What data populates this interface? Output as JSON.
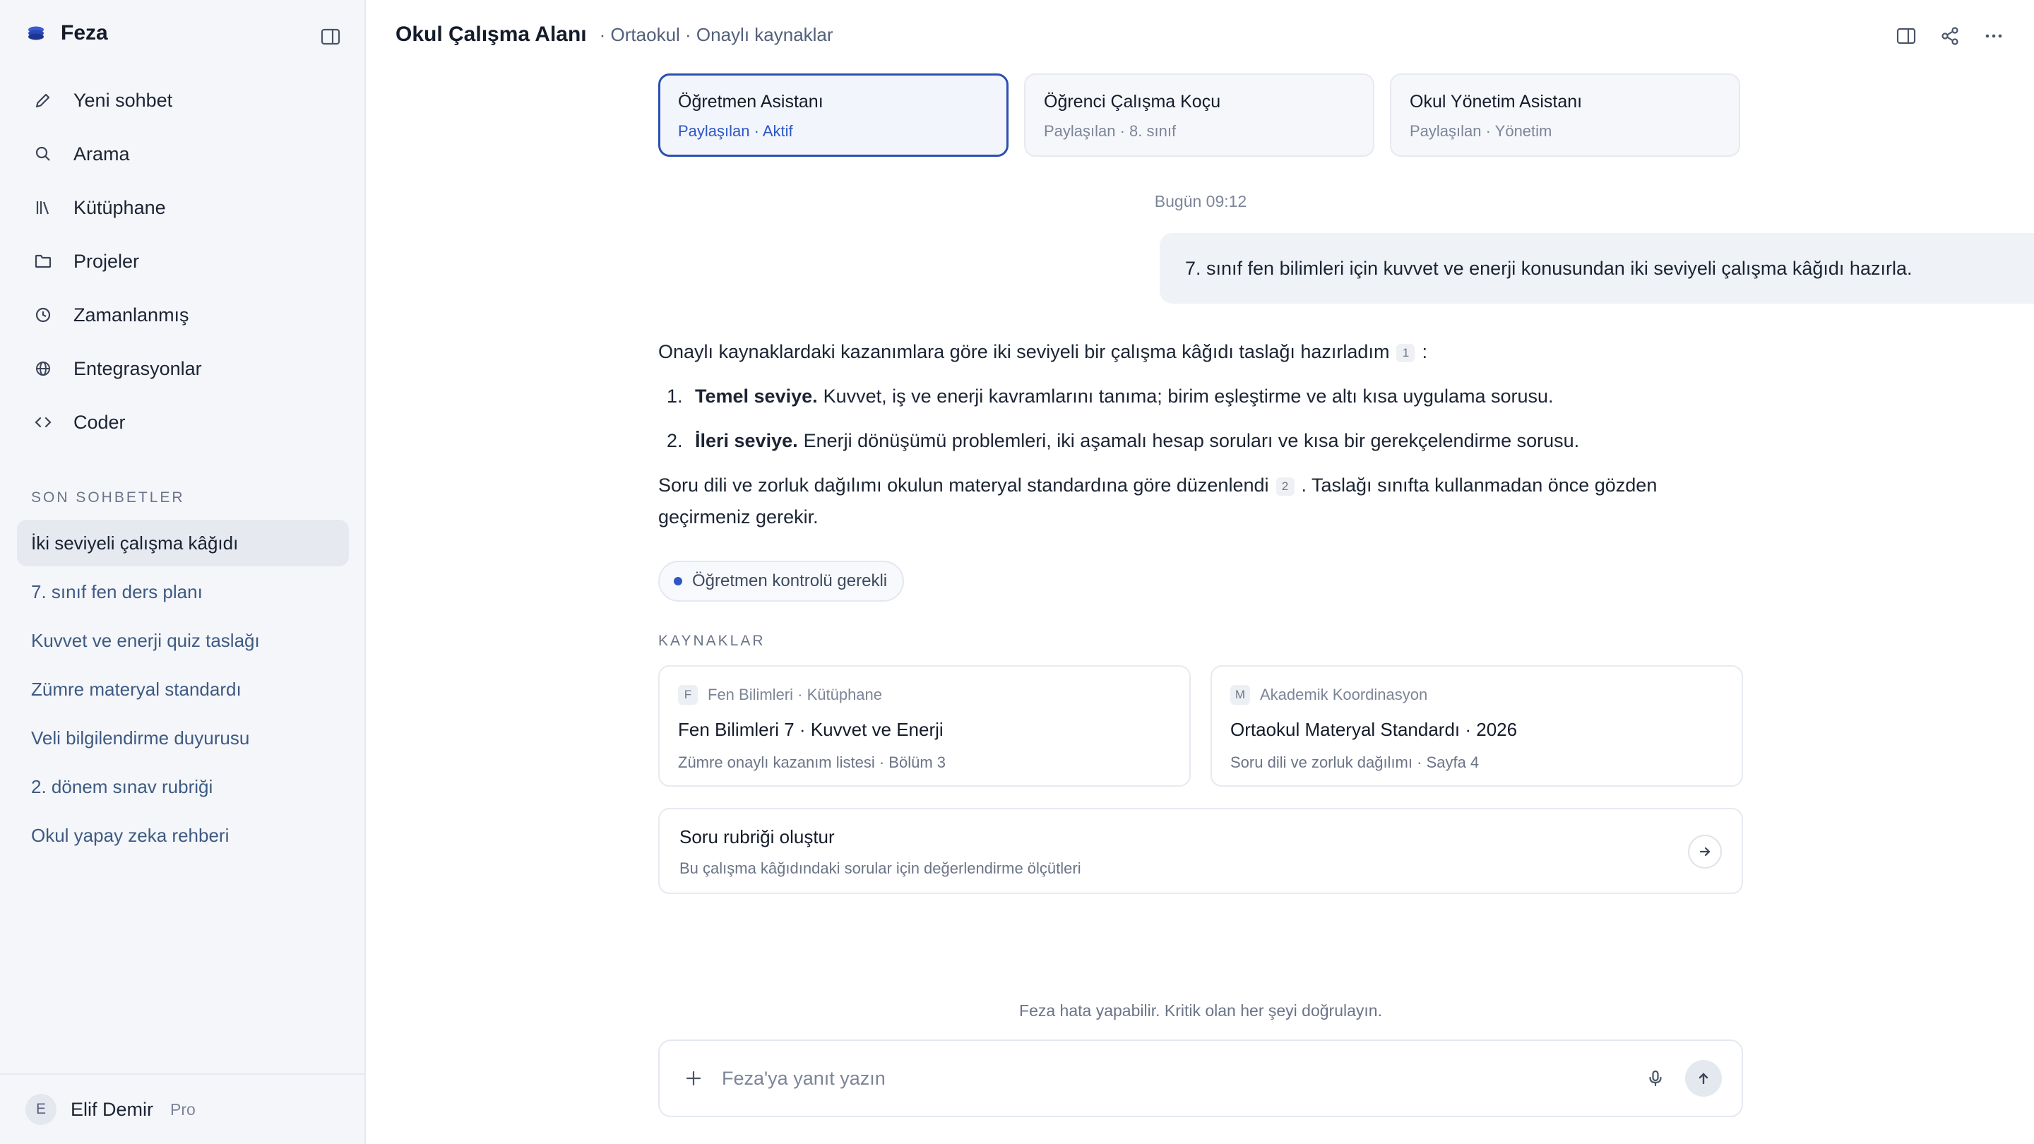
{
  "app": {
    "name": "Feza"
  },
  "sidebar": {
    "nav": [
      {
        "label": "Yeni sohbet",
        "icon": "pencil-icon"
      },
      {
        "label": "Arama",
        "icon": "search-icon"
      },
      {
        "label": "Kütüphane",
        "icon": "library-icon"
      },
      {
        "label": "Projeler",
        "icon": "folder-icon"
      },
      {
        "label": "Zamanlanmış",
        "icon": "clock-icon"
      },
      {
        "label": "Entegrasyonlar",
        "icon": "globe-icon"
      },
      {
        "label": "Coder",
        "icon": "code-icon"
      }
    ],
    "recents_title": "SON SOHBETLER",
    "recents": [
      "İki seviyeli çalışma kâğıdı",
      "7. sınıf fen ders planı",
      "Kuvvet ve enerji quiz taslağı",
      "Zümre materyal standardı",
      "Veli bilgilendirme duyurusu",
      "2. dönem sınav rubriği",
      "Okul yapay zeka rehberi"
    ],
    "user": {
      "initial": "E",
      "name": "Elif Demir",
      "plan": "Pro"
    }
  },
  "header": {
    "title": "Okul Çalışma Alanı",
    "subtitle": "· Ortaokul · Onaylı kaynaklar"
  },
  "assistants": [
    {
      "name": "Öğretmen Asistanı",
      "meta": "Paylaşılan · Aktif",
      "active": true
    },
    {
      "name": "Öğrenci Çalışma Koçu",
      "meta": "Paylaşılan · 8. sınıf",
      "active": false
    },
    {
      "name": "Okul Yönetim Asistanı",
      "meta": "Paylaşılan · Yönetim",
      "active": false
    }
  ],
  "conversation": {
    "timestamp": "Bugün 09:12",
    "user_message": "7. sınıf fen bilimleri için kuvvet ve enerji konusundan iki seviyeli çalışma kâğıdı hazırla.",
    "intro": "Onaylı kaynaklardaki kazanımlara göre iki seviyeli bir çalışma kâğıdı taslağı hazırladım",
    "intro_cite": "1",
    "intro_end": ":",
    "items": [
      {
        "num": "1.",
        "title": "Temel seviye.",
        "text": "Kuvvet, iş ve enerji kavramlarını tanıma; birim eşleştirme ve altı kısa uygulama sorusu."
      },
      {
        "num": "2.",
        "title": "İleri seviye.",
        "text": "Enerji dönüşümü problemleri, iki aşamalı hesap soruları ve kısa bir gerekçelendirme sorusu."
      }
    ],
    "outro_start": "Soru dili ve zorluk dağılımı okulun materyal standardına göre düzenlendi",
    "outro_cite": "2",
    "outro_end": ". Taslağı sınıfta kullanmadan önce gözden geçirmeniz gerekir.",
    "badge": "Öğretmen kontrolü gerekli"
  },
  "sources": {
    "title": "KAYNAKLAR",
    "items": [
      {
        "letter": "F",
        "origin": "Fen Bilimleri · Kütüphane",
        "title": "Fen Bilimleri 7 · Kuvvet ve Enerji",
        "detail": "Zümre onaylı kazanım listesi · Bölüm 3"
      },
      {
        "letter": "M",
        "origin": "Akademik Koordinasyon",
        "title": "Ortaokul Materyal Standardı · 2026",
        "detail": "Soru dili ve zorluk dağılımı · Sayfa 4"
      }
    ]
  },
  "suggestion": {
    "title": "Soru rubriği oluştur",
    "subtitle": "Bu çalışma kâğıdındaki sorular için değerlendirme ölçütleri"
  },
  "composer": {
    "disclaimer": "Feza hata yapabilir. Kritik olan her şeyi doğrulayın.",
    "placeholder": "Feza'ya yanıt yazın"
  },
  "colors": {
    "accent": "#2d57c7",
    "sidebar_bg": "#f4f6fa",
    "active_item_bg": "#e6e9f0"
  }
}
